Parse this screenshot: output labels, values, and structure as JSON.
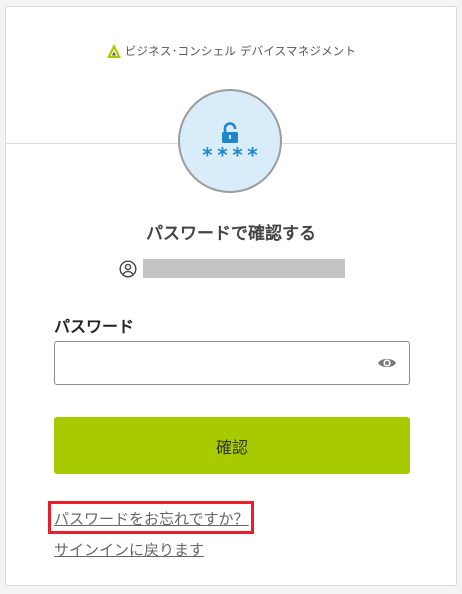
{
  "brand": {
    "name": "ビジネス･コンシェル デバイスマネジメント",
    "logo_icon": "brand-triangle-logo",
    "accent_color": "#a8cb00"
  },
  "hero": {
    "icon": "unlocked-padlock-icon",
    "pin_mask": "****",
    "circle_color": "#d8ecf9",
    "icon_color": "#1f86cc"
  },
  "heading": "パスワードで確認する",
  "user": {
    "icon": "user-circle-icon",
    "name_redacted": true
  },
  "password": {
    "label": "パスワード",
    "value": "",
    "placeholder": "",
    "toggle_icon": "eye-icon"
  },
  "confirm_button": {
    "label": "確認",
    "color": "#a8cb00"
  },
  "links": {
    "forgot_password": "パスワードをお忘れですか？",
    "back_to_signin": "サインインに戻ります"
  },
  "highlight": {
    "color": "#e8202a",
    "target": "forgot_password"
  }
}
